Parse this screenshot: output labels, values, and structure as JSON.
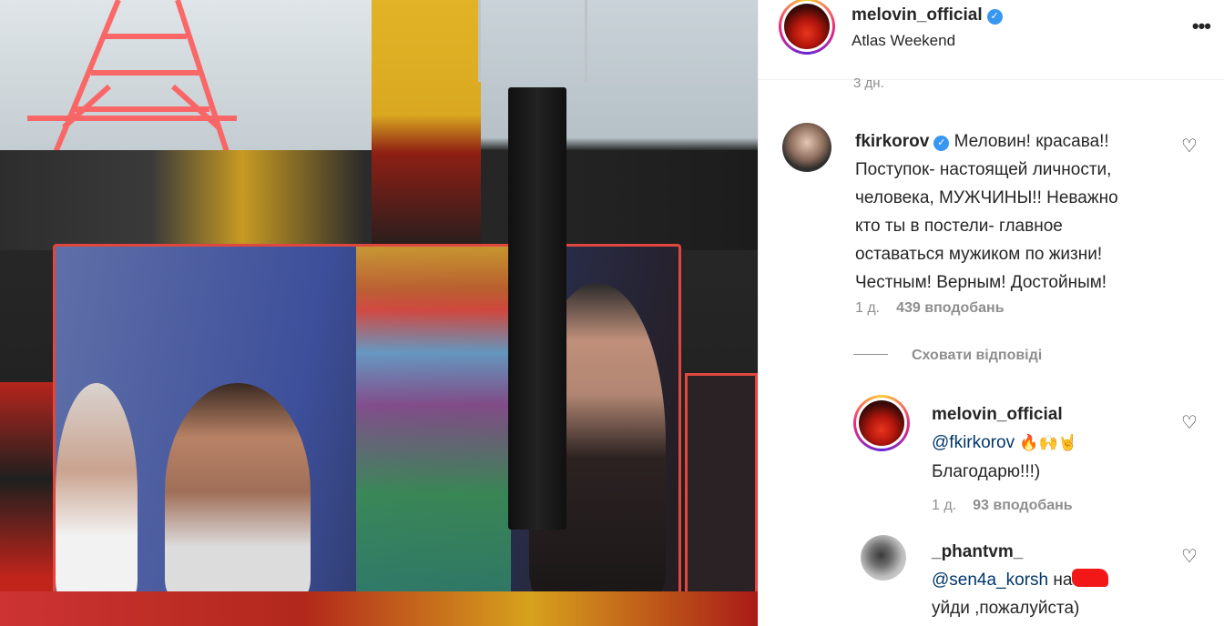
{
  "post": {
    "username": "melovin_official",
    "location": "Atlas Weekend",
    "time": "3 дн."
  },
  "comments": [
    {
      "username": "fkirkorov",
      "verified": true,
      "lines": [
        "Меловин! красава!!",
        "Поступок- настоящей личности,",
        "человека, МУЖЧИНЫ!! Неважно",
        "кто ты в постели- главное",
        "оставаться мужиком по жизни!",
        "Честным! Верным! Достойным!"
      ],
      "time": "1 д.",
      "likes": "439 вподобань"
    }
  ],
  "hide_replies": "Сховати відповіді",
  "replies": [
    {
      "username": "melovin_official",
      "mention": "@fkirkorov",
      "emojis": "🔥🙌🤘",
      "text": "Благодарю!!!)",
      "time": "1 д.",
      "likes": "93 вподобань"
    },
    {
      "username": "_phantvm_",
      "mention": "@sen4a_korsh",
      "text_part": "на",
      "text_line2": "уйди ,пожалуйста)"
    }
  ],
  "icons": {
    "more": "more-options-icon",
    "heart": "heart-outline-icon",
    "verified": "verified-badge-icon"
  }
}
